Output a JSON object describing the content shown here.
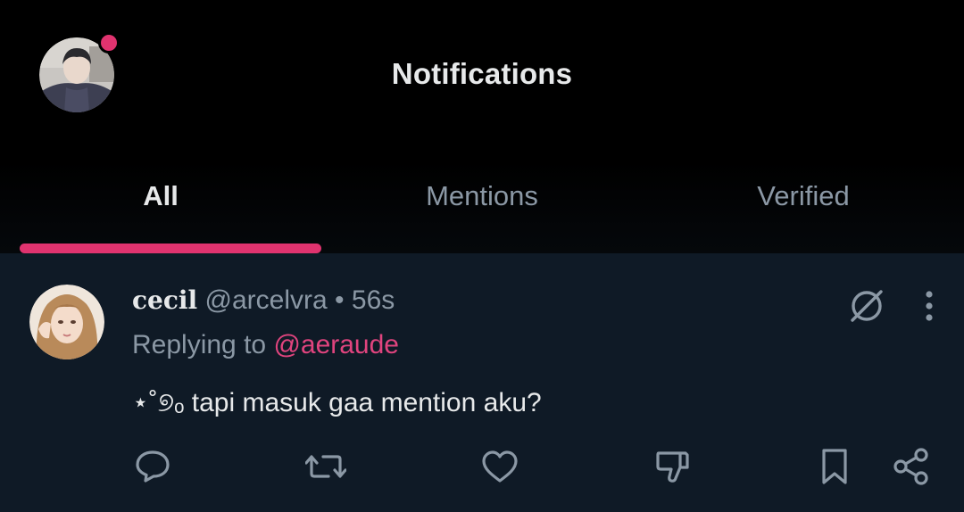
{
  "header": {
    "title": "Notifications"
  },
  "tabs": [
    {
      "label": "All",
      "active": true
    },
    {
      "label": "Mentions",
      "active": false
    },
    {
      "label": "Verified",
      "active": false
    }
  ],
  "tweet": {
    "display_name": "cecil",
    "handle": "@arcelvra",
    "separator": "•",
    "time": "56s",
    "reply_prefix": "Replying to",
    "reply_to": "@aeraude",
    "text": "⋆˚୭ₒ tapi masuk gaa mention aku?"
  },
  "icons": {
    "grok": "circle-slash-icon",
    "more": "more-vertical-icon",
    "reply": "reply-bubble-icon",
    "retweet": "retweet-icon",
    "like": "heart-icon",
    "dislike": "thumbs-down-icon",
    "bookmark": "bookmark-icon",
    "share": "share-icon"
  },
  "colors": {
    "accent": "#e0336f",
    "mention": "#e0447e",
    "background": "#000000",
    "feed_background": "#0f1a26",
    "text_primary": "#e7e9ea",
    "text_secondary": "#8b98a5"
  }
}
